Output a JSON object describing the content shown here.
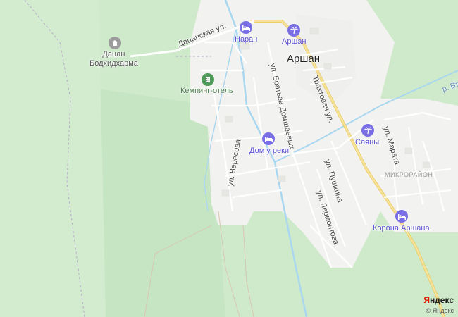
{
  "map": {
    "town_name": "Аршан",
    "district_label": "МИКРОРАЙОН",
    "streets": {
      "datsanskaya": "Дацанская ул.",
      "bratyev": "ул. Братьев Домшеевых",
      "traktovaya": "Трактовая ул.",
      "veresova": "ул. Вересова",
      "pushkina": "ул. Пушкина",
      "lermontova": "ул. Лермонтова",
      "marata": "ул. Марата",
      "vt": "р. Вт"
    },
    "pois": {
      "datsan": "Дацан\nБодхидхарма",
      "camping": "Кемпинг-отель",
      "naran": "Наран",
      "arshan_hotel": "Аршан",
      "dom_u_reki": "Дом у реки",
      "sayany": "Саяны",
      "korona": "Корона Аршана"
    },
    "icons": {
      "hotel": "bed-icon",
      "resort": "palm-tree-icon",
      "temple": "temple-icon",
      "camping": "building-icon"
    },
    "colors": {
      "forest": "#cfeacb",
      "built_area": "#f2f2f0",
      "road": "#ffffff",
      "main_road": "#f7e29a",
      "river": "#a9d7ef",
      "poi_icon": "#7a6ee6"
    }
  },
  "attribution": {
    "logo_prefix": "Я",
    "logo_rest": "ндекс",
    "copyright": "© Яндекс"
  }
}
